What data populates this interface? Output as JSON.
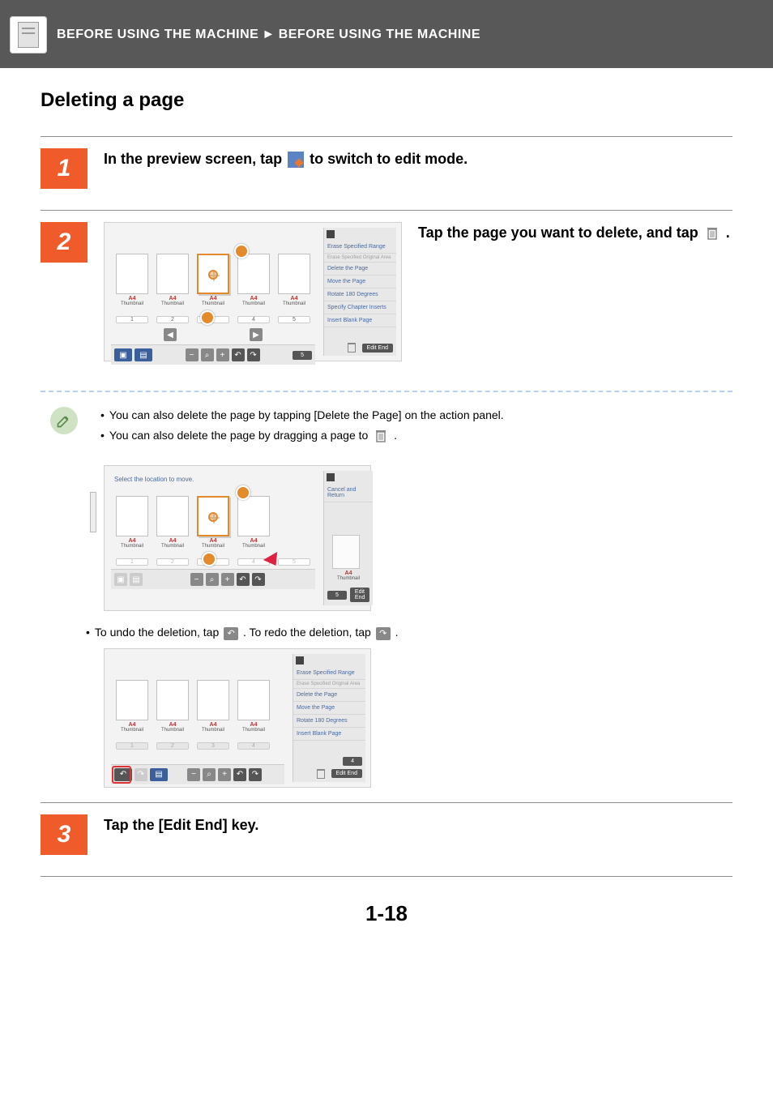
{
  "breadcrumb": {
    "section": "BEFORE USING THE MACHINE",
    "page": "BEFORE USING THE MACHINE"
  },
  "title": "Deleting a page",
  "steps": {
    "s1": {
      "num": "1",
      "pre": "In the preview screen, tap ",
      "post": " to switch to edit mode."
    },
    "s2": {
      "num": "2",
      "pre": "Tap the page you want to delete, and tap ",
      "post": " ."
    },
    "s3": {
      "num": "3",
      "text": "Tap the [Edit End] key."
    }
  },
  "notes": {
    "n1": "You can also delete the page by tapping [Delete the Page] on the action panel.",
    "n2_pre": "You can also delete the page by dragging a page to ",
    "n2_post": " .",
    "undo_pre": "To undo the deletion, tap ",
    "undo_mid": " . To redo the deletion, tap ",
    "undo_post": " ."
  },
  "panel_common": {
    "thumb_size": "A4",
    "thumb_label": "Thumbnail",
    "edit_end": "Edit End"
  },
  "panel1": {
    "action_items": {
      "a": "Erase Specified Range",
      "a_sub": "Erase Specified Original Area",
      "b": "Delete the Page",
      "c": "Move the Page",
      "d": "Rotate 180 Degrees",
      "e": "Specify Chapter Inserts",
      "f": "Insert Blank Page"
    },
    "nums": [
      "1",
      "2",
      "3",
      "4",
      "5"
    ],
    "count": "5"
  },
  "panel2": {
    "top_msg": "Select the location to move.",
    "action_items": {
      "a": "Cancel and Return"
    },
    "nums": [
      "1",
      "2",
      "3",
      "4",
      "5"
    ],
    "count": "5"
  },
  "panel3": {
    "action_items": {
      "a": "Erase Specified Range",
      "a_sub": "Erase Specified Original Area",
      "b": "Delete the Page",
      "c": "Move the Page",
      "d": "Rotate 180 Degrees",
      "e": "Insert Blank Page"
    },
    "nums": [
      "1",
      "2",
      "3",
      "4"
    ],
    "count": "4"
  },
  "page_number": "1-18"
}
